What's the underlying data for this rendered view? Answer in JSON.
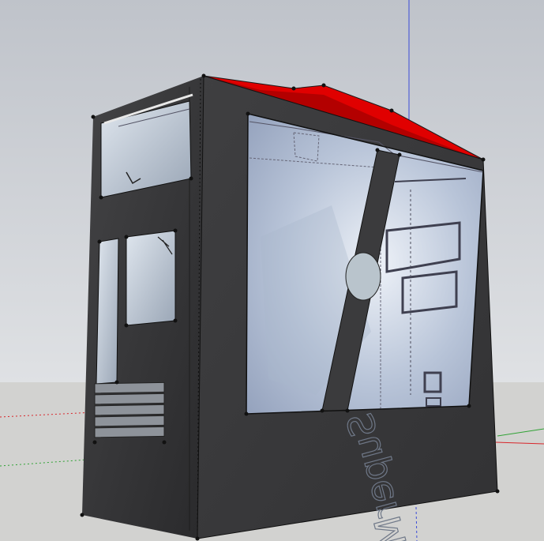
{
  "scene": {
    "window_text": "SuperM",
    "colors": {
      "sky": "#c9ccd2",
      "ground": "#d2d2d0",
      "case_body": "#3b3b3d",
      "case_front": "#333335",
      "case_top": "#e00000",
      "glass": "#c8d2e2",
      "axis_red": "#d8262b",
      "axis_green": "#2fa234",
      "axis_blue": "#3a4bd8"
    }
  }
}
